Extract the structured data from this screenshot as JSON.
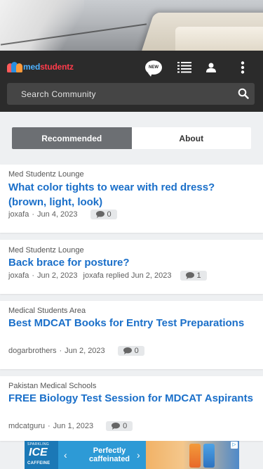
{
  "header": {
    "logo": {
      "part1": "med",
      "part2": "studentz"
    },
    "new_badge": "NEW",
    "icons": [
      "new-posts-icon",
      "list-icon",
      "user-icon",
      "more-vertical-icon"
    ]
  },
  "search": {
    "placeholder": "Search Community",
    "icon": "search-icon"
  },
  "tabs": [
    {
      "label": "Recommended",
      "active": true
    },
    {
      "label": "About",
      "active": false
    }
  ],
  "threads": [
    {
      "forum": "Med Studentz Lounge",
      "title": "What color tights to wear with red dress? (brown, light, look)",
      "author": "joxafa",
      "date": "Jun 4, 2023",
      "extra": "",
      "replies": "0"
    },
    {
      "forum": "Med Studentz Lounge",
      "title": "Back brace for posture?",
      "author": "joxafa",
      "date": "Jun 2, 2023",
      "extra": "joxafa replied Jun 2, 2023",
      "replies": "1"
    },
    {
      "forum": "Medical Students Area",
      "title": "Best MDCAT Books for Entry Test Preparations",
      "author": "dogarbrothers",
      "date": "Jun 2, 2023",
      "extra": "",
      "replies": "0"
    },
    {
      "forum": "Pakistan Medical Schools",
      "title": "FREE Biology Test Session for MDCAT Aspirants",
      "author": "mdcatguru",
      "date": "Jun 1, 2023",
      "extra": "",
      "replies": "0"
    }
  ],
  "ad": {
    "brand_top": "SPARKLING",
    "brand": "ICE",
    "brand_bottom": "CAFFEINE",
    "headline": "Perfectly caffeinated",
    "prev": "‹",
    "next": "›",
    "choices": "▷"
  },
  "colors": {
    "header_bg": "#2b2b2b",
    "link": "#1a6fc9",
    "tab_active": "#6c6f73",
    "logo_blue": "#4fb2ff",
    "logo_red": "#ff3b4b"
  }
}
